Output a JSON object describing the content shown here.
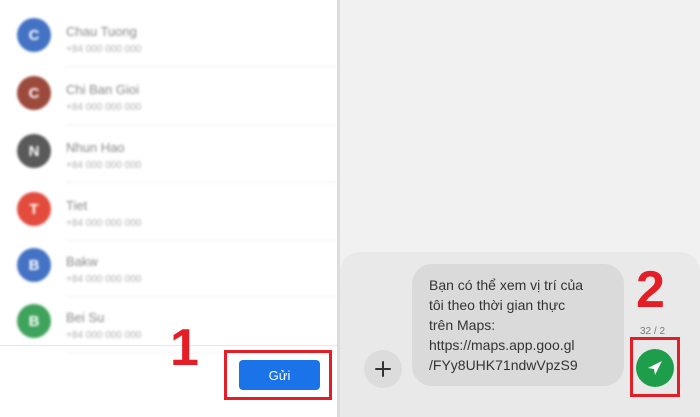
{
  "contacts": [
    {
      "name": "Chau Tuong",
      "number": "+84 000 000 000",
      "initial": "C",
      "color": "#4472c4"
    },
    {
      "name": "Chi Ban Gioi",
      "number": "+84 000 000 000",
      "initial": "C",
      "color": "#9c4a3c"
    },
    {
      "name": "Nhun Hao",
      "number": "+84 000 000 000",
      "initial": "N",
      "color": "#5a5a5a"
    },
    {
      "name": "Tiet",
      "number": "+84 000 000 000",
      "initial": "T",
      "color": "#e34c3d"
    },
    {
      "name": "Bakw",
      "number": "+84 000 000 000",
      "initial": "B",
      "color": "#4472c4"
    },
    {
      "name": "Bei Su",
      "number": "+84 000 000 000",
      "initial": "B",
      "color": "#3fa35c"
    }
  ],
  "annotations": {
    "step1": "1",
    "step2": "2",
    "highlight_color": "#e31e26"
  },
  "share_dialog": {
    "send_label": "Gửi",
    "button_color": "#1a73e8"
  },
  "composer": {
    "message": "Bạn có thể xem vị trí của\ntôi theo thời gian thực\ntrên Maps:\nhttps://maps.app.goo.gl\n/FYy8UHK71ndwVpzS9",
    "char_count": "32 / 2",
    "add_icon": "plus-icon",
    "send_icon": "send-arrow-icon",
    "send_color": "#1e9e4a"
  }
}
